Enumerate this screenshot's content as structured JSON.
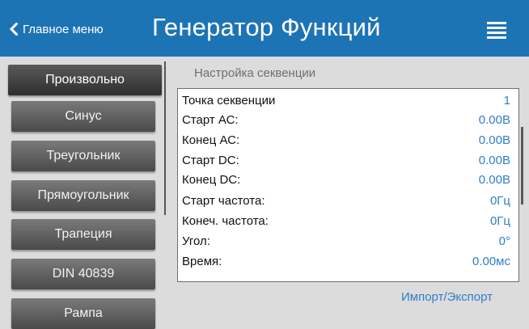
{
  "header": {
    "back_label": "Главное меню",
    "title": "Генератор Функций",
    "bg_color": "#1d74b5"
  },
  "sidebar": {
    "items": [
      {
        "label": "Произвольно",
        "active": true
      },
      {
        "label": "Синус",
        "active": false
      },
      {
        "label": "Треугольник",
        "active": false
      },
      {
        "label": "Прямоугольник",
        "active": false
      },
      {
        "label": "Трапеция",
        "active": false
      },
      {
        "label": "DIN 40839",
        "active": false
      },
      {
        "label": "Рампа",
        "active": false
      }
    ]
  },
  "panel": {
    "title": "Настройка секвенции",
    "rows": [
      {
        "label": "Точка секвенции",
        "value": "1"
      },
      {
        "label": "Старт АС:",
        "value": "0.00В"
      },
      {
        "label": "Конец АС:",
        "value": "0.00В"
      },
      {
        "label": "Старт DC:",
        "value": "0.00В"
      },
      {
        "label": "Конец DC:",
        "value": "0.00В"
      },
      {
        "label": "Старт частота:",
        "value": "0Гц"
      },
      {
        "label": "Конеч. частота:",
        "value": "0Гц"
      },
      {
        "label": "Угол:",
        "value": "0°"
      },
      {
        "label": "Время:",
        "value": "0.00мс"
      }
    ],
    "value_color": "#2e7fc8"
  },
  "import_export_label": "Импорт/Экспорт",
  "icons": {
    "back": "chevron-left-icon",
    "menu": "hamburger-menu-icon"
  }
}
